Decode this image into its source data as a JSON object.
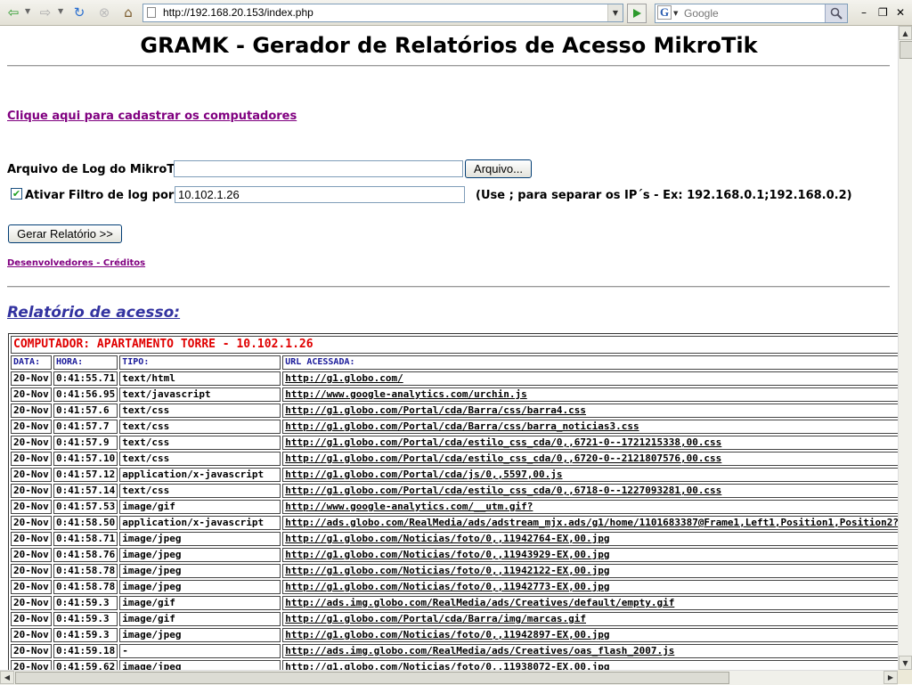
{
  "browser": {
    "url": "http://192.168.20.153/index.php",
    "search_placeholder": "Google",
    "search_engine_letter": "G"
  },
  "page": {
    "title": "GRAMK - Gerador de Relatórios de Acesso MikroTik",
    "register_link": "Clique aqui para cadastrar os computadores",
    "log_file_label": "Arquivo de Log do MikroTik:",
    "log_file_value": "",
    "browse_button": "Arquivo...",
    "filter_label": "Ativar Filtro de log por IP:",
    "filter_checked": true,
    "filter_value": "10.102.1.26",
    "filter_hint": "(Use ; para separar os IP´s - Ex: 192.168.0.1;192.168.0.2)",
    "generate_button": "Gerar Relatório >>",
    "credits_link": "Desenvolvedores - Créditos",
    "report_title": "Relatório de acesso: "
  },
  "report": {
    "computer": "COMPUTADOR: APARTAMENTO TORRE - 10.102.1.26",
    "columns": [
      "DATA:",
      "HORA:",
      "TIPO:",
      "URL ACESSADA:"
    ],
    "rows": [
      [
        "20-Nov",
        "0:41:55.71",
        "text/html",
        "http://g1.globo.com/"
      ],
      [
        "20-Nov",
        "0:41:56.95",
        "text/javascript",
        "http://www.google-analytics.com/urchin.js"
      ],
      [
        "20-Nov",
        "0:41:57.6",
        "text/css",
        "http://g1.globo.com/Portal/cda/Barra/css/barra4.css"
      ],
      [
        "20-Nov",
        "0:41:57.7",
        "text/css",
        "http://g1.globo.com/Portal/cda/Barra/css/barra_noticias3.css"
      ],
      [
        "20-Nov",
        "0:41:57.9",
        "text/css",
        "http://g1.globo.com/Portal/cda/estilo_css_cda/0,,6721-0--1721215338,00.css"
      ],
      [
        "20-Nov",
        "0:41:57.10",
        "text/css",
        "http://g1.globo.com/Portal/cda/estilo_css_cda/0,,6720-0--2121807576,00.css"
      ],
      [
        "20-Nov",
        "0:41:57.12",
        "application/x-javascript",
        "http://g1.globo.com/Portal/cda/js/0,,5597,00.js"
      ],
      [
        "20-Nov",
        "0:41:57.14",
        "text/css",
        "http://g1.globo.com/Portal/cda/estilo_css_cda/0,,6718-0--1227093281,00.css"
      ],
      [
        "20-Nov",
        "0:41:57.53",
        "image/gif",
        "http://www.google-analytics.com/__utm.gif?"
      ],
      [
        "20-Nov",
        "0:41:58.50",
        "application/x-javascript",
        "http://ads.globo.com/RealMedia/ads/adstream_mjx.ads/g1/home/1101683387@Frame1,Left1,Position1,Position2?"
      ],
      [
        "20-Nov",
        "0:41:58.71",
        "image/jpeg",
        "http://g1.globo.com/Noticias/foto/0,,11942764-EX,00.jpg"
      ],
      [
        "20-Nov",
        "0:41:58.76",
        "image/jpeg",
        "http://g1.globo.com/Noticias/foto/0,,11943929-EX,00.jpg"
      ],
      [
        "20-Nov",
        "0:41:58.78",
        "image/jpeg",
        "http://g1.globo.com/Noticias/foto/0,,11942122-EX,00.jpg"
      ],
      [
        "20-Nov",
        "0:41:58.78",
        "image/jpeg",
        "http://g1.globo.com/Noticias/foto/0,,11942773-EX,00.jpg"
      ],
      [
        "20-Nov",
        "0:41:59.3",
        "image/gif",
        "http://ads.img.globo.com/RealMedia/ads/Creatives/default/empty.gif"
      ],
      [
        "20-Nov",
        "0:41:59.3",
        "image/gif",
        "http://g1.globo.com/Portal/cda/Barra/img/marcas.gif"
      ],
      [
        "20-Nov",
        "0:41:59.3",
        "image/jpeg",
        "http://g1.globo.com/Noticias/foto/0,,11942897-EX,00.jpg"
      ],
      [
        "20-Nov",
        "0:41:59.18",
        "-",
        "http://ads.img.globo.com/RealMedia/ads/Creatives/oas_flash_2007.js"
      ],
      [
        "20-Nov",
        "0:41:59.62",
        "image/jpeg",
        "http://g1.globo.com/Noticias/foto/0,,11938072-EX,00.jpg"
      ]
    ]
  },
  "colors": {
    "computer_header": "#e00000",
    "column_header": "#1a1a9a",
    "visited_link": "#800080",
    "report_title": "#3333a0"
  }
}
